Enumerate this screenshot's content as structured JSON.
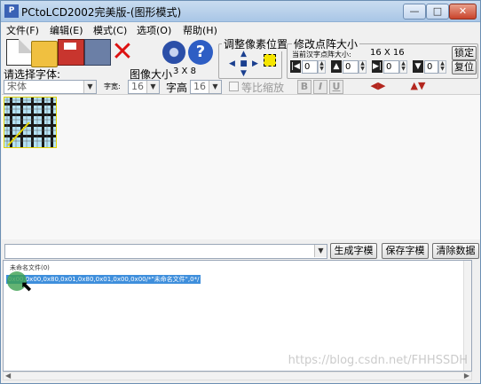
{
  "window": {
    "title": "PCtoLCD2002完美版-(图形模式)",
    "app_icon_text": "P",
    "min_glyph": "—",
    "max_glyph": "□",
    "close_glyph": "✕"
  },
  "menu": {
    "items": [
      "文件(F)",
      "编辑(E)",
      "模式(C)",
      "选项(O)",
      "帮助(H)"
    ]
  },
  "toolbar": {
    "delete_glyph": "✕",
    "help_glyph": "?"
  },
  "adjust_group": {
    "title": "调整像素位置"
  },
  "resize_group": {
    "title": "修改点阵大小",
    "current_label": "当前汉字点阵大小:",
    "size_value": "16 X 16",
    "spin_values": [
      "0",
      "0",
      "0",
      "0"
    ],
    "lock_label": "锁定",
    "restore_label": "复位"
  },
  "font_row": {
    "select_font_label": "请选择字体:",
    "font_value": "宋体",
    "image_size_label": "图像大小",
    "image_size_value": "3 X 8",
    "char_width_label": "字宽:",
    "char_width_value": "16",
    "char_height_label": "字高",
    "char_height_value": "16",
    "proportional_label": "等比缩放",
    "bold_label": "B",
    "italic_label": "I",
    "underline_label": "U"
  },
  "bottom_bar": {
    "generate_label": "生成字模",
    "save_label": "保存字模",
    "clear_label": "清除数据"
  },
  "output": {
    "header_line": "未命名文件(0)",
    "data_line": "0x00,0x00,0x80,0x01,0x80,0x01,0x00,0x00/*\"未命名文件\",0*/"
  },
  "watermark": "https://blog.csdn.net/FHHSSDH"
}
